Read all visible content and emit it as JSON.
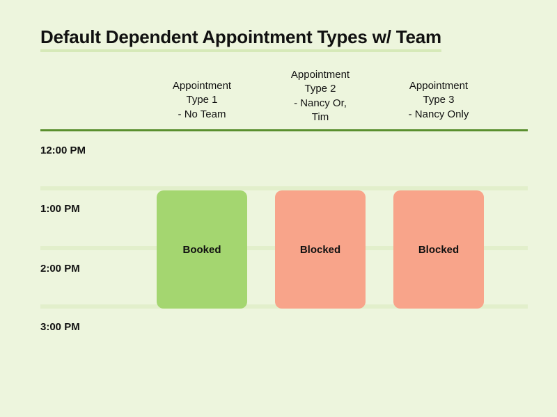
{
  "title": "Default Dependent Appointment Types w/ Team",
  "columns": [
    {
      "line1": "Appointment",
      "line2": "Type 1",
      "line3": "- No Team"
    },
    {
      "line1": "Appointment",
      "line2": "Type 2",
      "line3": "- Nancy Or,",
      "line4": "Tim"
    },
    {
      "line1": "Appointment",
      "line2": "Type 3",
      "line3": "- Nancy Only"
    }
  ],
  "times": [
    "12:00 PM",
    "1:00 PM",
    "2:00 PM",
    "3:00 PM"
  ],
  "blocks": [
    {
      "label": "Booked",
      "status": "booked"
    },
    {
      "label": "Blocked",
      "status": "blocked"
    },
    {
      "label": "Blocked",
      "status": "blocked"
    }
  ],
  "colors": {
    "background": "#edf5dd",
    "divider": "#5a8f2e",
    "gridline": "#e2efcb",
    "booked": "#a4d670",
    "blocked": "#f8a48a"
  }
}
